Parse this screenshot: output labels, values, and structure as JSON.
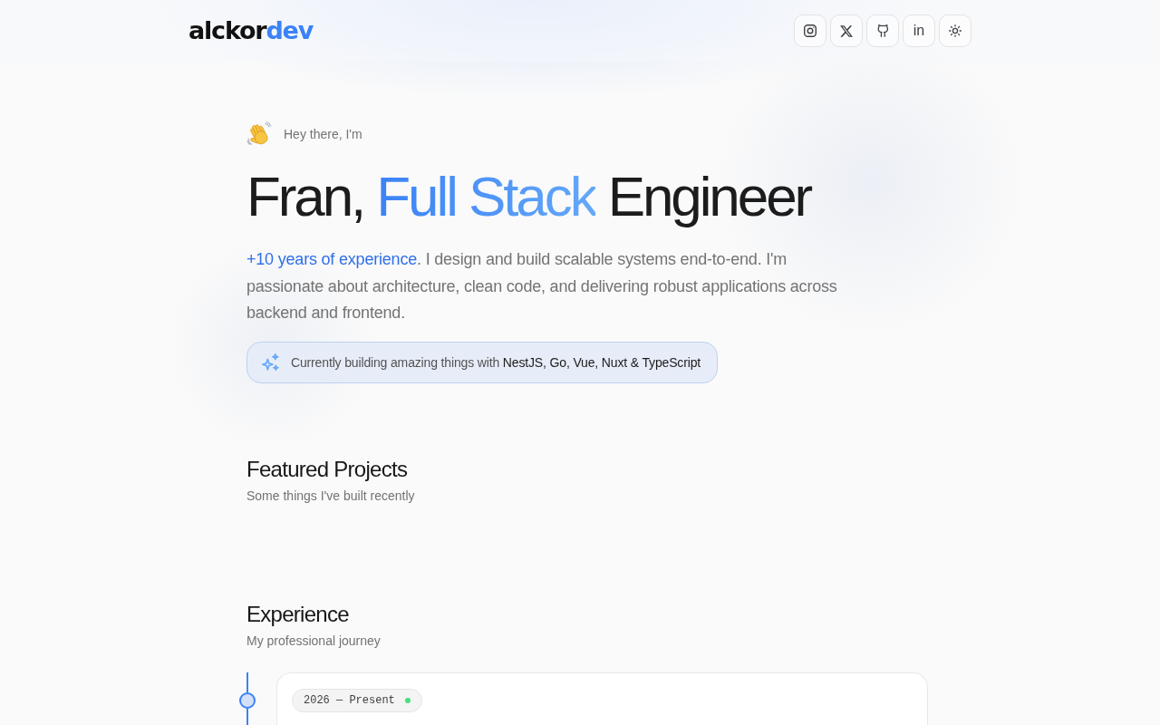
{
  "header": {
    "logo": {
      "main": "alckor",
      "accent": "dev"
    },
    "icon_buttons": [
      {
        "kind": "instagram"
      },
      {
        "kind": "x"
      },
      {
        "kind": "github"
      },
      {
        "kind": "linkedin",
        "label": "in"
      },
      {
        "kind": "theme"
      }
    ]
  },
  "hero": {
    "greeting": "Hey there, I'm",
    "headline": {
      "before": "Fran, ",
      "accent": "Full Stack",
      "after": " Engineer"
    },
    "intro": {
      "accent": "+10 years of experience",
      "rest": ". I design and build scalable systems end-to-end. I'm passionate about architecture, clean code, and delivering robust applications across backend and frontend."
    },
    "badge": {
      "text": "Currently building amazing things with ",
      "tech": "NestJS, Go, Vue, Nuxt & TypeScript"
    }
  },
  "projects_section": {
    "title": "Featured Projects",
    "subtitle": "Some things I've built recently"
  },
  "experience_section": {
    "title": "Experience",
    "subtitle": "My professional journey",
    "items": [
      {
        "period": "2026 — Present",
        "current": true
      }
    ]
  }
}
